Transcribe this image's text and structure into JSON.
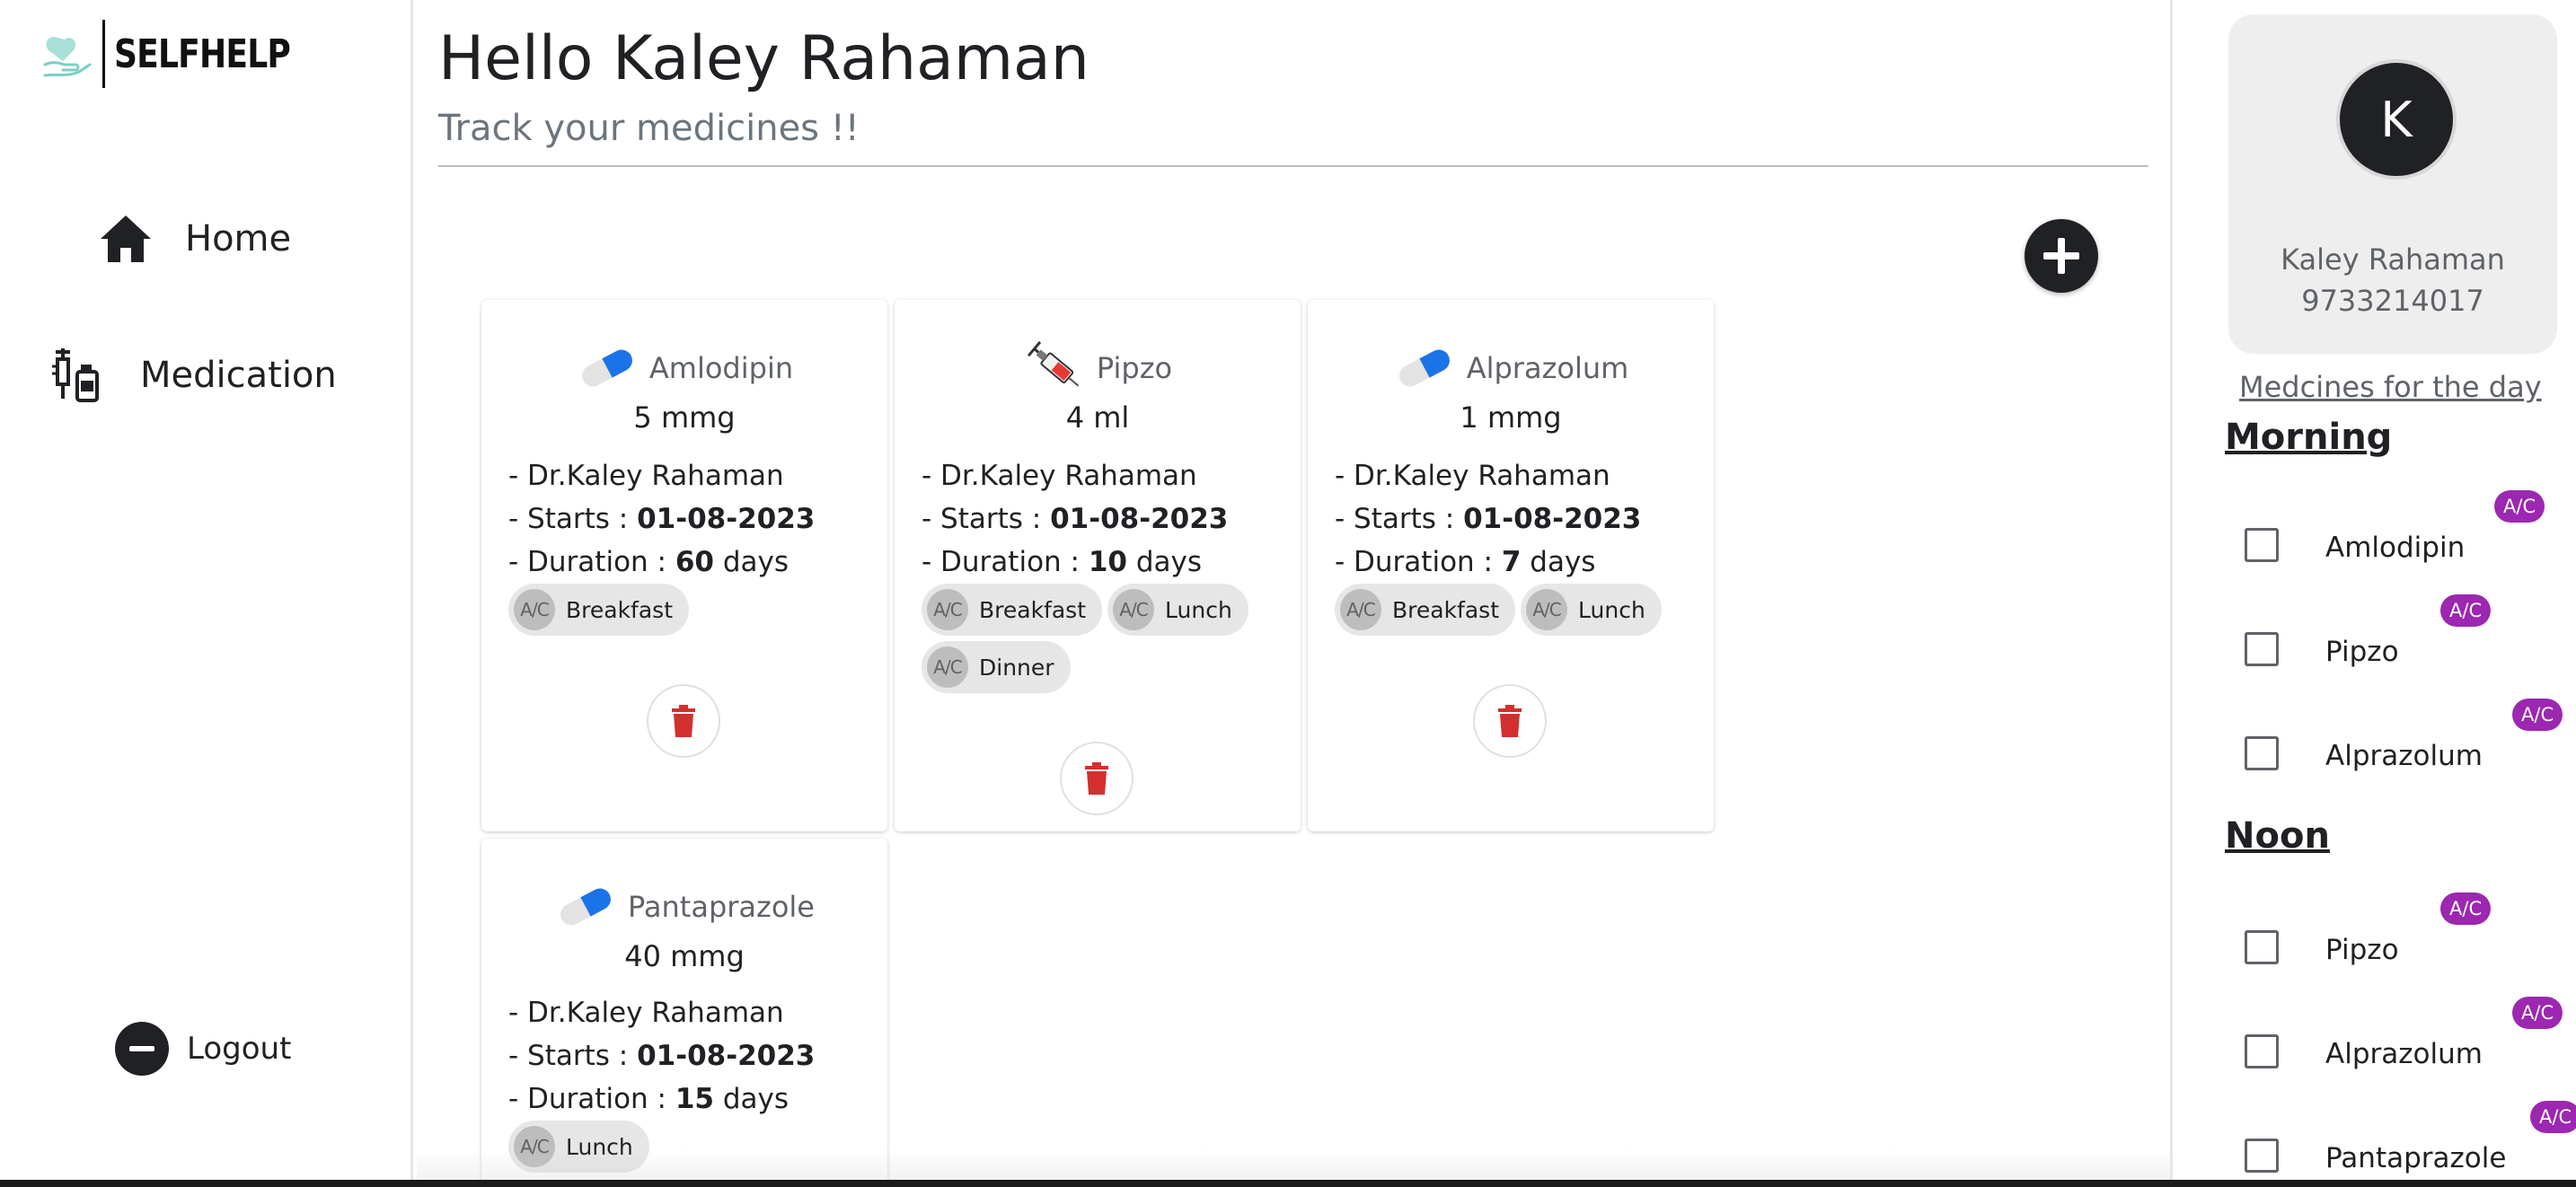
{
  "brand": {
    "name": "SELFHELP"
  },
  "nav": {
    "home": {
      "label": "Home",
      "icon": "home-icon"
    },
    "medication": {
      "label": "Medication",
      "icon": "medication-icon"
    },
    "logout": {
      "label": "Logout",
      "icon": "minus-circle-icon"
    }
  },
  "header": {
    "greeting": "Hello Kaley Rahaman",
    "subtitle": "Track your medicines !!"
  },
  "cards": [
    {
      "name": "Amlodipin",
      "icon": "pill-icon",
      "dose": "5 mmg",
      "doctor": "- Dr.Kaley Rahaman",
      "starts_prefix": "- Starts : ",
      "starts": "01-08-2023",
      "duration_prefix": "- Duration : ",
      "duration": "60",
      "duration_suffix": " days",
      "chips": [
        "Breakfast"
      ]
    },
    {
      "name": "Pipzo",
      "icon": "syringe-icon",
      "dose": "4 ml",
      "doctor": "- Dr.Kaley Rahaman",
      "starts_prefix": "- Starts : ",
      "starts": "01-08-2023",
      "duration_prefix": "- Duration : ",
      "duration": "10",
      "duration_suffix": " days",
      "chips": [
        "Breakfast",
        "Lunch",
        "Dinner"
      ]
    },
    {
      "name": "Alprazolum",
      "icon": "pill-icon",
      "dose": "1 mmg",
      "doctor": "- Dr.Kaley Rahaman",
      "starts_prefix": "- Starts : ",
      "starts": "01-08-2023",
      "duration_prefix": "- Duration : ",
      "duration": "7",
      "duration_suffix": " days",
      "chips": [
        "Breakfast",
        "Lunch"
      ]
    },
    {
      "name": "Pantaprazole",
      "icon": "pill-icon",
      "dose": "40 mmg",
      "doctor": "- Dr.Kaley Rahaman",
      "starts_prefix": "- Starts : ",
      "starts": "01-08-2023",
      "duration_prefix": "- Duration : ",
      "duration": "15",
      "duration_suffix": " days",
      "chips": [
        "Lunch"
      ]
    }
  ],
  "chip_avatar": "A/C",
  "profile": {
    "initial": "K",
    "name": "Kaley Rahaman",
    "phone": "9733214017"
  },
  "schedule": {
    "title": "Medcines for the day",
    "morning": {
      "label": "Morning",
      "items": [
        {
          "name": "Amlodipin",
          "badge": "A/C",
          "checked": false
        },
        {
          "name": "Pipzo",
          "badge": "A/C",
          "checked": false
        },
        {
          "name": "Alprazolum",
          "badge": "A/C",
          "checked": false
        }
      ]
    },
    "noon": {
      "label": "Noon",
      "items": [
        {
          "name": "Pipzo",
          "badge": "A/C",
          "checked": false
        },
        {
          "name": "Alprazolum",
          "badge": "A/C",
          "checked": false
        },
        {
          "name": "Pantaprazole",
          "badge": "A/C",
          "checked": false
        }
      ]
    }
  },
  "colors": {
    "badge": "#9c27b0",
    "delete": "#d32f2f",
    "dark": "#202124",
    "pill_blue": "#1a73e8"
  }
}
